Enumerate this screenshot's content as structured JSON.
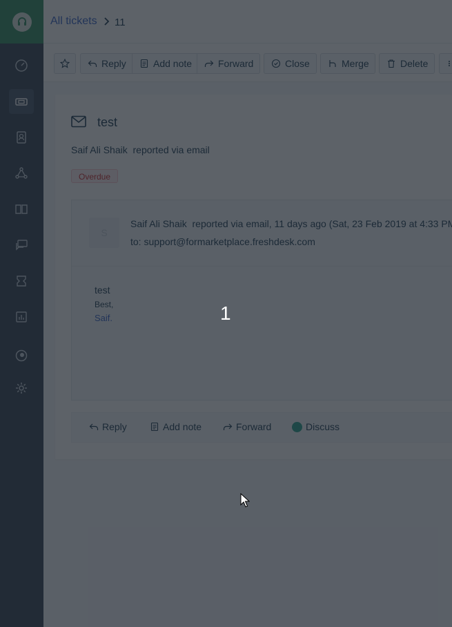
{
  "breadcrumb": {
    "link": "All tickets",
    "current": "11"
  },
  "sidebar": {
    "items": [
      {
        "icon": "dashboard-icon"
      },
      {
        "icon": "tickets-icon",
        "active": true
      },
      {
        "icon": "contacts-icon"
      },
      {
        "icon": "social-icon"
      },
      {
        "icon": "solutions-icon"
      },
      {
        "icon": "forums-icon"
      },
      {
        "icon": "gamification-icon"
      },
      {
        "icon": "reports-icon"
      },
      {
        "icon": "freshchat-icon"
      },
      {
        "icon": "admin-gear-icon"
      }
    ]
  },
  "toolbar": {
    "reply_label": "Reply",
    "add_note_label": "Add note",
    "forward_label": "Forward",
    "close_label": "Close",
    "merge_label": "Merge",
    "delete_label": "Delete"
  },
  "ticket": {
    "subject": "test",
    "reporter_name": "Saif Ali Shaik",
    "reported_via": "reported via email",
    "status_badge": "Overdue"
  },
  "conversation": {
    "avatar_initial": "S",
    "sender": "Saif Ali Shaik",
    "meta": "reported via email, 11 days ago (Sat, 23 Feb 2019 at 4:33 PM",
    "to": "to: support@formarketplace.freshdesk.com",
    "body": [
      "test",
      "Best,",
      "Saif."
    ]
  },
  "actions": {
    "reply_label": "Reply",
    "add_note_label": "Add note",
    "forward_label": "Forward",
    "discuss_label": "Discuss"
  },
  "overlay": {
    "step_number": "1"
  },
  "colors": {
    "sidebar": "#2b3a4d",
    "brand": "#2a8a5a",
    "link": "#2c5cc5",
    "overdue": "#c82124"
  }
}
